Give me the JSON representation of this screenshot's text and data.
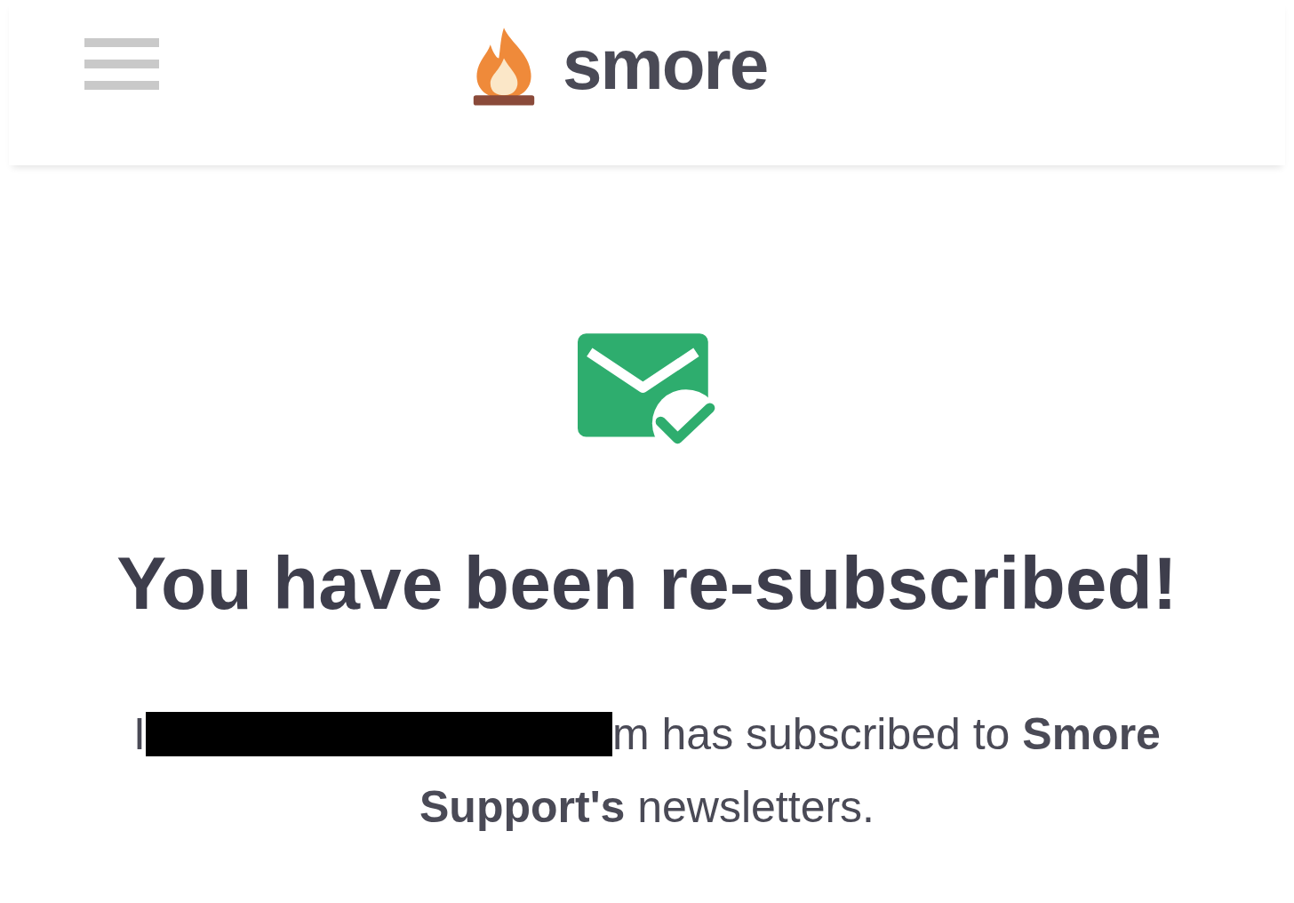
{
  "header": {
    "brand": "smore"
  },
  "confirmation": {
    "title": "You have been re-subscribed!",
    "email_start": "I",
    "redacted": true,
    "message": "m has subscribed to **Smore Support's** newsletters."
  }
}
